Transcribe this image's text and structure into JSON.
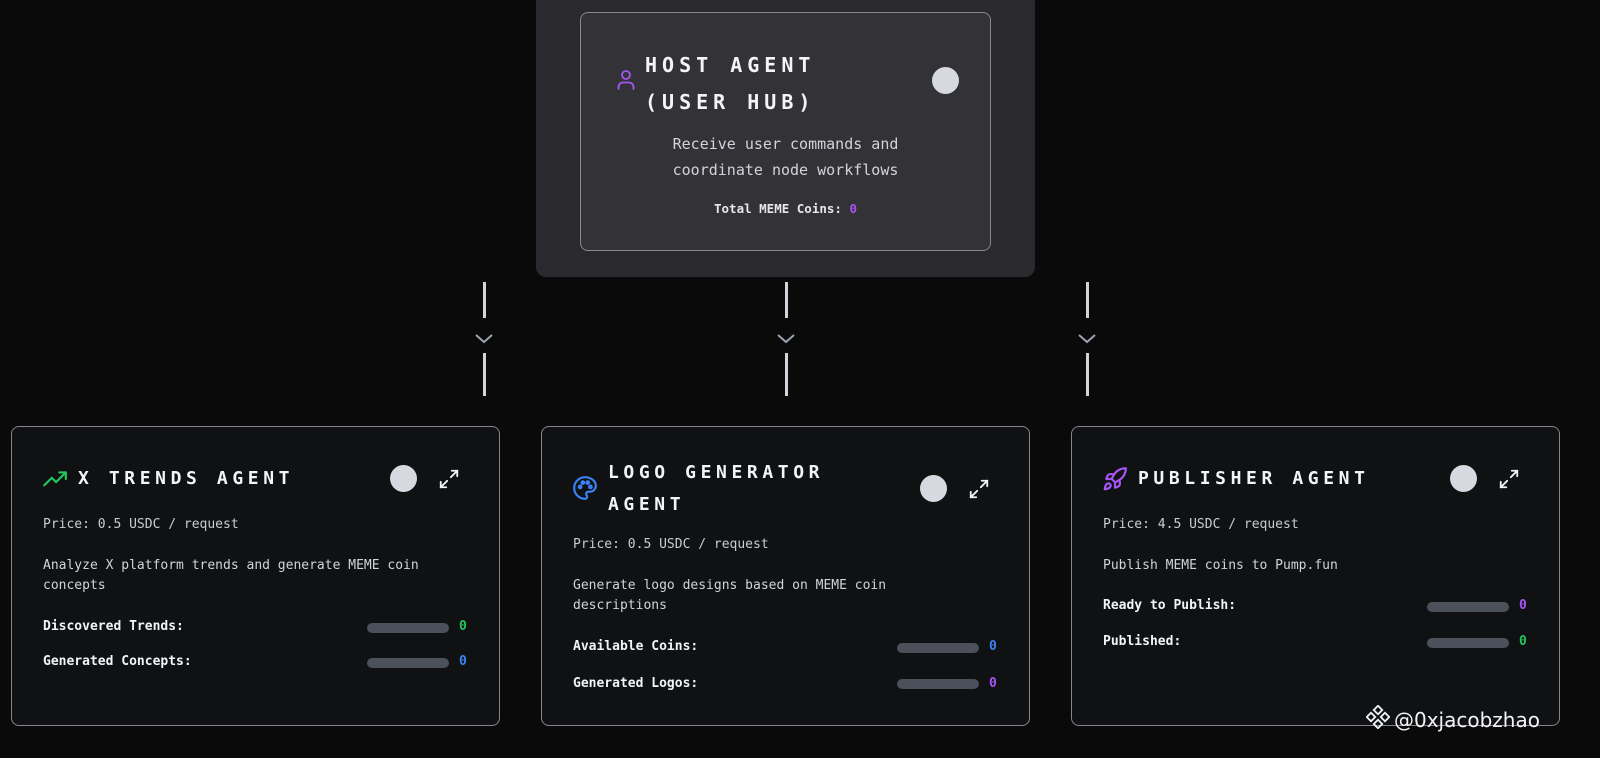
{
  "host": {
    "title": "HOST AGENT (USER HUB)",
    "description": "Receive user commands and coordinate node workflows",
    "total_label": "Total MEME Coins:",
    "total_value": "0",
    "icon": "user-icon",
    "icon_color": "#a855f7"
  },
  "agents": [
    {
      "title": "X TRENDS AGENT",
      "icon": "trending-up-icon",
      "icon_color": "#22c55e",
      "price": "Price: 0.5 USDC / request",
      "description": "Analyze X platform trends and generate MEME coin concepts",
      "metrics": [
        {
          "label": "Discovered Trends:",
          "value": "0",
          "color": "#22c55e"
        },
        {
          "label": "Generated Concepts:",
          "value": "0",
          "color": "#3b82f6"
        }
      ]
    },
    {
      "title": "LOGO GENERATOR AGENT",
      "icon": "palette-icon",
      "icon_color": "#3b82f6",
      "price": "Price: 0.5 USDC / request",
      "description": "Generate logo designs based on MEME coin descriptions",
      "metrics": [
        {
          "label": "Available Coins:",
          "value": "0",
          "color": "#3b82f6"
        },
        {
          "label": "Generated Logos:",
          "value": "0",
          "color": "#a855f7"
        }
      ]
    },
    {
      "title": "PUBLISHER AGENT",
      "icon": "rocket-icon",
      "icon_color": "#a855f7",
      "price": "Price: 4.5 USDC / request",
      "description": "Publish MEME coins to Pump.fun",
      "metrics": [
        {
          "label": "Ready to Publish:",
          "value": "0",
          "color": "#a855f7"
        },
        {
          "label": "Published:",
          "value": "0",
          "color": "#22c55e"
        }
      ]
    }
  ],
  "watermark": {
    "text": "@0xjacobzhao",
    "icon": "binance-logo-icon"
  }
}
